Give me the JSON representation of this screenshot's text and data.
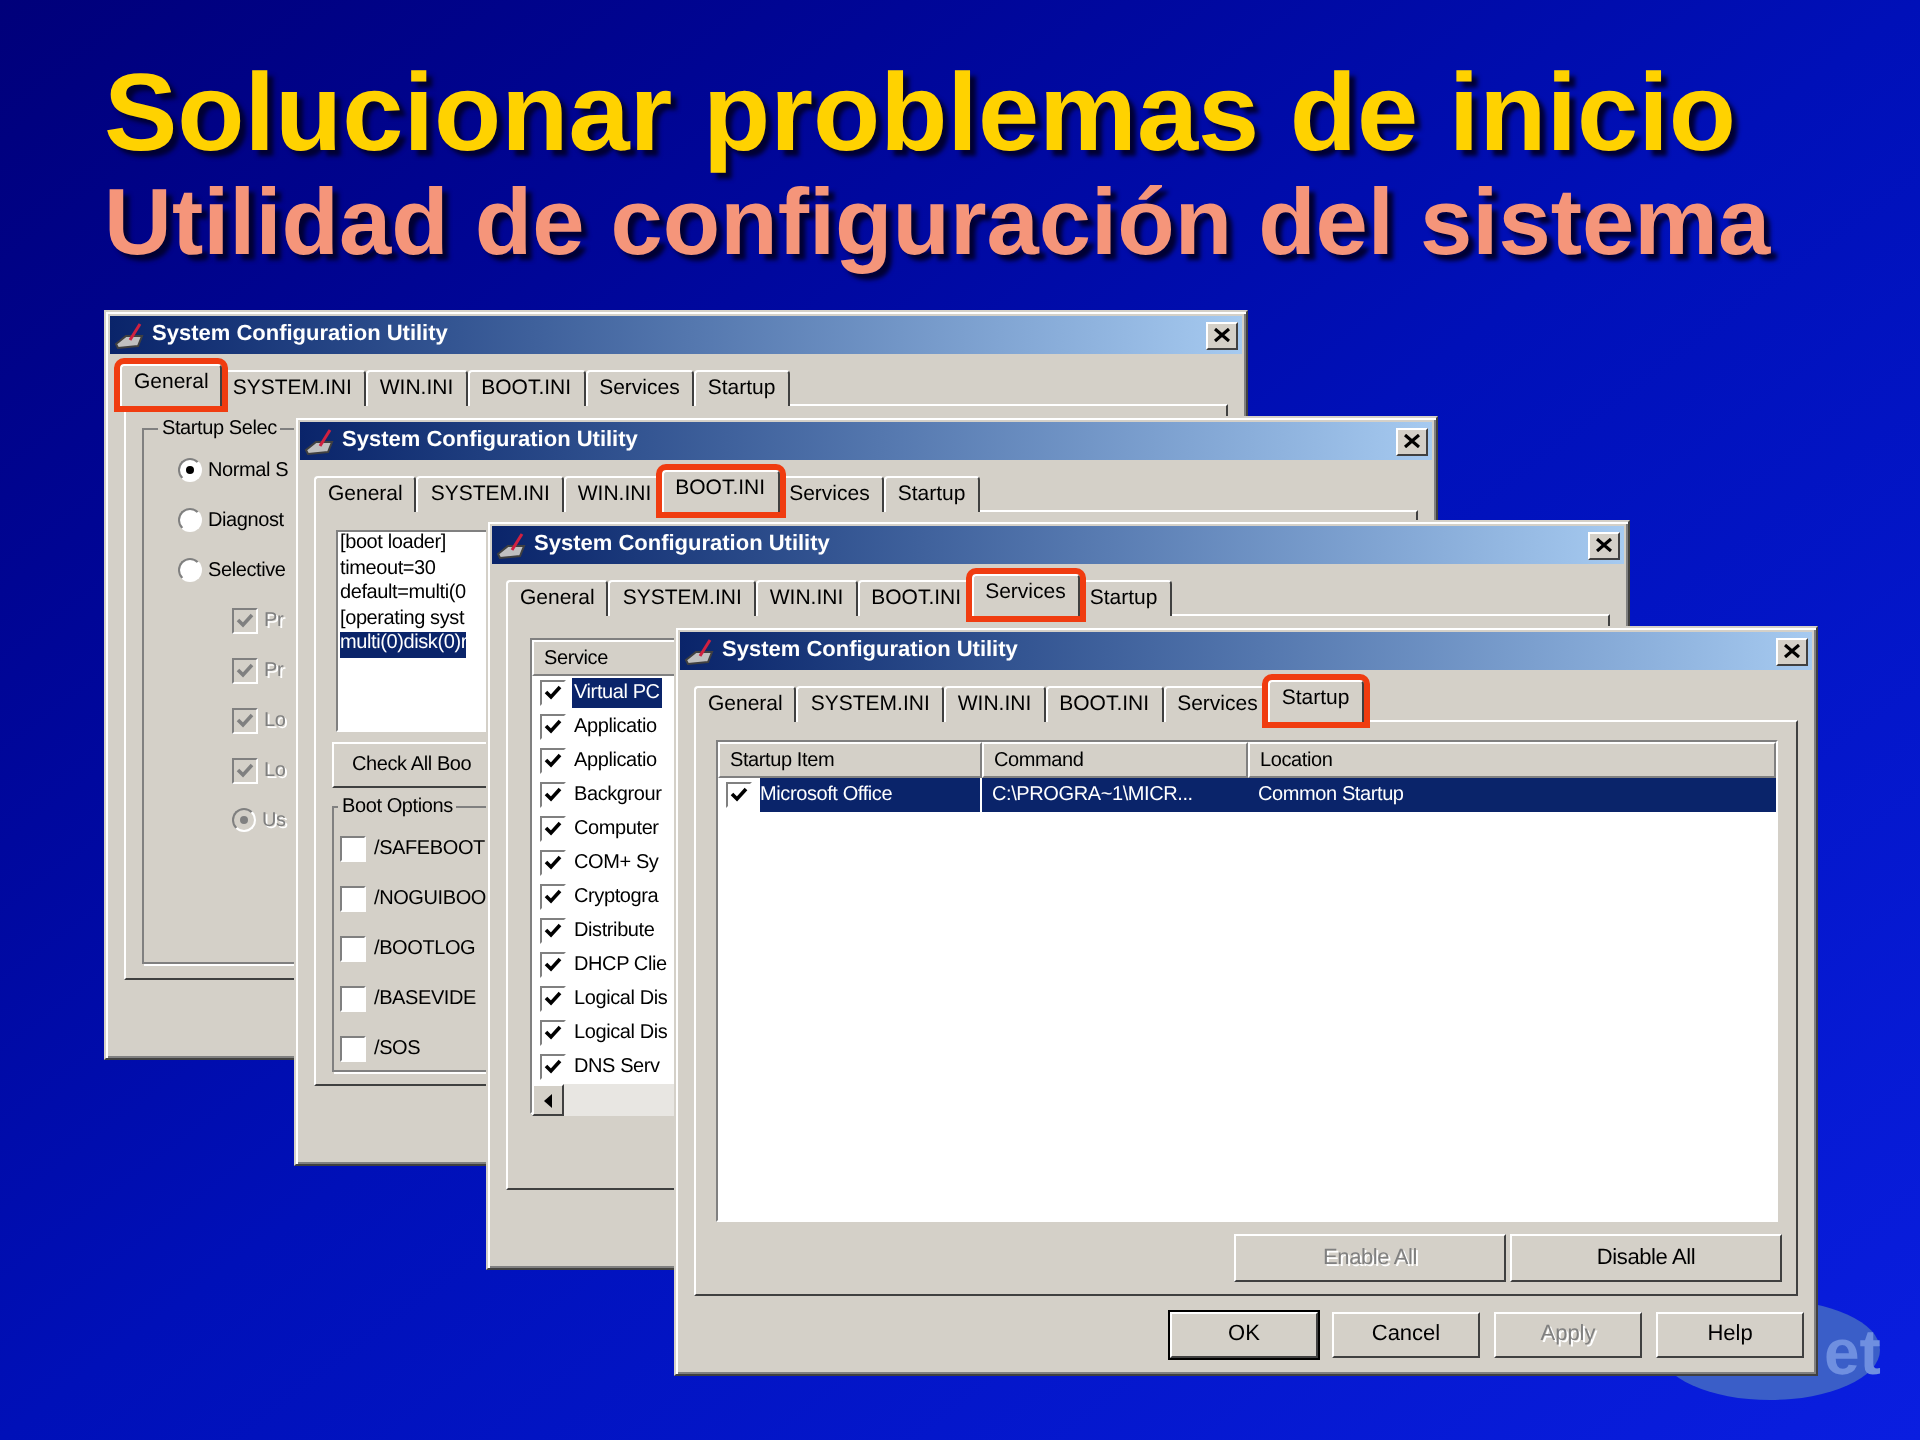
{
  "slide": {
    "title": "Solucionar problemas de inicio",
    "subtitle": "Utilidad de configuración del sistema"
  },
  "logo": {
    "text": "et"
  },
  "windows": [
    {
      "title": "System Configuration Utility",
      "kind": "general",
      "tabs": [
        {
          "label": "General",
          "selected": true,
          "highlighted": true
        },
        {
          "label": "SYSTEM.INI",
          "selected": false,
          "highlighted": false
        },
        {
          "label": "WIN.INI",
          "selected": false,
          "highlighted": false
        },
        {
          "label": "BOOT.INI",
          "selected": false,
          "highlighted": false
        },
        {
          "label": "Services",
          "selected": false,
          "highlighted": false
        },
        {
          "label": "Startup",
          "selected": false,
          "highlighted": false
        }
      ],
      "group": "Startup Selec",
      "options": [
        {
          "kind": "radio",
          "label": "Normal S",
          "checked": true,
          "disabled": false
        },
        {
          "kind": "radio",
          "label": "Diagnost",
          "checked": false,
          "disabled": false
        },
        {
          "kind": "radio",
          "label": "Selective",
          "checked": false,
          "disabled": false,
          "children": [
            {
              "kind": "checkbox",
              "label": "Pr",
              "checked": true,
              "disabled": true
            },
            {
              "kind": "checkbox",
              "label": "Pr",
              "checked": true,
              "disabled": true
            },
            {
              "kind": "checkbox",
              "label": "Lo",
              "checked": true,
              "disabled": true
            },
            {
              "kind": "checkbox",
              "label": "Lo",
              "checked": true,
              "disabled": true
            },
            {
              "kind": "radio",
              "label": "Us",
              "checked": true,
              "disabled": true
            }
          ]
        }
      ]
    },
    {
      "title": "System Configuration Utility",
      "kind": "boot_ini",
      "tabs": [
        {
          "label": "General",
          "selected": false,
          "highlighted": false
        },
        {
          "label": "SYSTEM.INI",
          "selected": false,
          "highlighted": false
        },
        {
          "label": "WIN.INI",
          "selected": false,
          "highlighted": false
        },
        {
          "label": "BOOT.INI",
          "selected": true,
          "highlighted": true
        },
        {
          "label": "Services",
          "selected": false,
          "highlighted": false
        },
        {
          "label": "Startup",
          "selected": false,
          "highlighted": false
        }
      ],
      "lines": [
        {
          "text": "[boot loader]",
          "selected": false
        },
        {
          "text": "timeout=30",
          "selected": false
        },
        {
          "text": "default=multi(0",
          "selected": false
        },
        {
          "text": "[operating syst",
          "selected": false
        },
        {
          "text": "multi(0)disk(0)r",
          "selected": true
        }
      ],
      "button": "Check All Boo",
      "group": "Boot Options",
      "options": [
        {
          "label": "/SAFEBOOT",
          "checked": false
        },
        {
          "label": "/NOGUIBOO",
          "checked": false
        },
        {
          "label": "/BOOTLOG",
          "checked": false
        },
        {
          "label": "/BASEVIDE",
          "checked": false
        },
        {
          "label": "/SOS",
          "checked": false
        }
      ]
    },
    {
      "title": "System Configuration Utility",
      "kind": "services",
      "tabs": [
        {
          "label": "General",
          "selected": false,
          "highlighted": false
        },
        {
          "label": "SYSTEM.INI",
          "selected": false,
          "highlighted": false
        },
        {
          "label": "WIN.INI",
          "selected": false,
          "highlighted": false
        },
        {
          "label": "BOOT.INI",
          "selected": false,
          "highlighted": false
        },
        {
          "label": "Services",
          "selected": true,
          "highlighted": true
        },
        {
          "label": "Startup",
          "selected": false,
          "highlighted": false
        }
      ],
      "column": "Service",
      "rows": [
        {
          "name": "Virtual PC",
          "checked": true,
          "selected": true
        },
        {
          "name": "Applicatio",
          "checked": true,
          "selected": false
        },
        {
          "name": "Applicatio",
          "checked": true,
          "selected": false
        },
        {
          "name": "Backgrour",
          "checked": true,
          "selected": false
        },
        {
          "name": "Computer",
          "checked": true,
          "selected": false
        },
        {
          "name": "COM+ Sy",
          "checked": true,
          "selected": false
        },
        {
          "name": "Cryptogra",
          "checked": true,
          "selected": false
        },
        {
          "name": "Distribute",
          "checked": true,
          "selected": false
        },
        {
          "name": "DHCP Clie",
          "checked": true,
          "selected": false
        },
        {
          "name": "Logical Dis",
          "checked": true,
          "selected": false
        },
        {
          "name": "Logical Dis",
          "checked": true,
          "selected": false
        },
        {
          "name": "DNS Serv",
          "checked": true,
          "selected": false
        }
      ]
    },
    {
      "title": "System Configuration Utility",
      "kind": "startup",
      "tabs": [
        {
          "label": "General",
          "selected": false,
          "highlighted": false
        },
        {
          "label": "SYSTEM.INI",
          "selected": false,
          "highlighted": false
        },
        {
          "label": "WIN.INI",
          "selected": false,
          "highlighted": false
        },
        {
          "label": "BOOT.INI",
          "selected": false,
          "highlighted": false
        },
        {
          "label": "Services",
          "selected": false,
          "highlighted": false
        },
        {
          "label": "Startup",
          "selected": true,
          "highlighted": true
        }
      ],
      "columns": [
        "Startup Item",
        "Command",
        "Location"
      ],
      "rows": [
        {
          "cells": [
            "Microsoft Office",
            "C:\\PROGRA~1\\MICR...",
            "Common Startup"
          ],
          "checked": true,
          "selected": true
        }
      ],
      "list_buttons": [
        {
          "label": "Enable All",
          "disabled": true
        },
        {
          "label": "Disable All",
          "disabled": false
        }
      ],
      "buttons": [
        {
          "label": "OK",
          "disabled": false,
          "default": true
        },
        {
          "label": "Cancel",
          "disabled": false,
          "default": false
        },
        {
          "label": "Apply",
          "disabled": true,
          "default": false
        },
        {
          "label": "Help",
          "disabled": false,
          "default": false
        }
      ]
    }
  ]
}
